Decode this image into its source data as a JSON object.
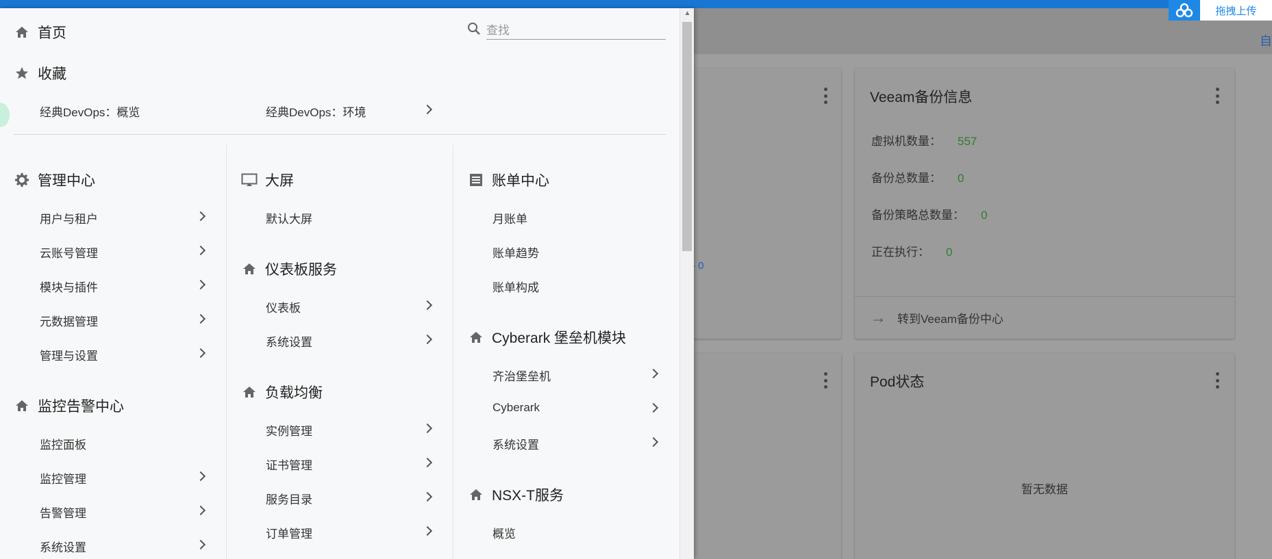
{
  "upload": {
    "label": "拖拽上传"
  },
  "bg_header": {
    "text": "自"
  },
  "bg_link": "- 0",
  "veeam_card": {
    "title": "Veeam备份信息",
    "rows": [
      {
        "label": "虚拟机数量：",
        "value": "557"
      },
      {
        "label": "备份总数量：",
        "value": "0"
      },
      {
        "label": "备份策略总数量：",
        "value": "0"
      },
      {
        "label": "正在执行：",
        "value": "0"
      }
    ],
    "footer": "转到Veeam备份中心"
  },
  "pod_card": {
    "title": "Pod状态",
    "empty": "暂无数据"
  },
  "menu": {
    "home": "首页",
    "favorites": "收藏",
    "fav_items": [
      "经典DevOps：概览",
      "经典DevOps：环境"
    ],
    "search_placeholder": "查找",
    "admin": {
      "title": "管理中心",
      "items": [
        "用户与租户",
        "云账号管理",
        "模块与插件",
        "元数据管理",
        "管理与设置"
      ]
    },
    "monitor": {
      "title": "监控告警中心",
      "items": [
        "监控面板",
        "监控管理",
        "告警管理",
        "系统设置"
      ]
    },
    "bigscreen": {
      "title": "大屏",
      "items": [
        "默认大屏"
      ]
    },
    "dashboard": {
      "title": "仪表板服务",
      "items": [
        "仪表板",
        "系统设置"
      ]
    },
    "lb": {
      "title": "负载均衡",
      "items": [
        "实例管理",
        "证书管理",
        "服务目录",
        "订单管理"
      ]
    },
    "billing": {
      "title": "账单中心",
      "items": [
        "月账单",
        "账单趋势",
        "账单构成"
      ]
    },
    "cyberark": {
      "title": "Cyberark 堡垒机模块",
      "items": [
        "齐治堡垒机",
        "Cyberark",
        "系统设置"
      ]
    },
    "nsx": {
      "title": "NSX-T服务",
      "items": [
        "概览"
      ]
    }
  },
  "colors": {
    "topbar": "#1976d2",
    "accent_value": "#2e7d32",
    "drawer_bg": "#f7f8f9"
  }
}
